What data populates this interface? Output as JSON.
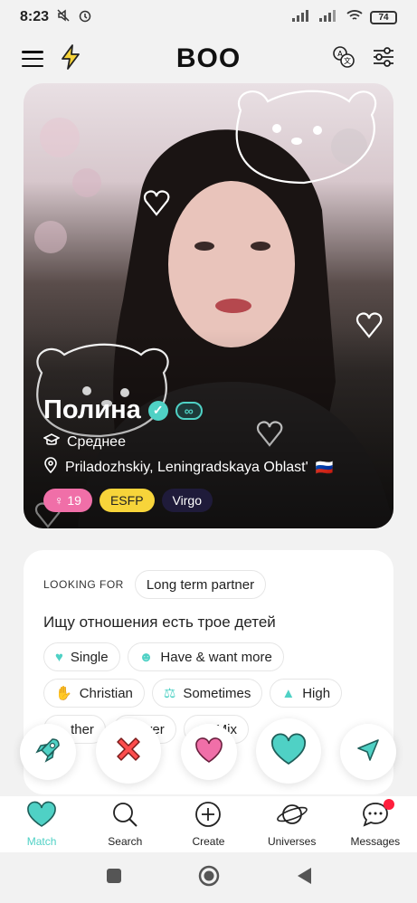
{
  "status_bar": {
    "time": "8:23",
    "battery": "74"
  },
  "header": {
    "logo": "BOO"
  },
  "profile": {
    "name": "Полина",
    "education": "Среднее",
    "location": "Priladozhskiy, Leningradskaya Oblast'",
    "flag": "🇷🇺",
    "tags": {
      "age": "19",
      "mbti": "ESFP",
      "zodiac": "Virgo"
    }
  },
  "about": {
    "looking_for_label": "LOOKING FOR",
    "looking_for_value": "Long term partner",
    "bio": "Ищу отношения есть трое детей",
    "pills": [
      {
        "icon": "heart-icon",
        "label": "Single"
      },
      {
        "icon": "baby-icon",
        "label": "Have & want more"
      },
      {
        "icon": "praying-hands-icon",
        "label": "Christian"
      },
      {
        "icon": "dumbbell-icon",
        "label": "Sometimes"
      },
      {
        "icon": "graduation-icon",
        "label": "High"
      },
      {
        "icon": "globe-icon",
        "label": "ther"
      },
      {
        "icon": "smoke-icon",
        "label": "ver"
      },
      {
        "icon": "cocktail-icon",
        "label": "Mix"
      }
    ]
  },
  "nav": {
    "match": "Match",
    "search": "Search",
    "create": "Create",
    "universes": "Universes",
    "messages": "Messages"
  },
  "colors": {
    "accent": "#4fd1c5",
    "pink": "#f06fa8",
    "yellow": "#f7d43a",
    "red": "#ff1e3c"
  }
}
